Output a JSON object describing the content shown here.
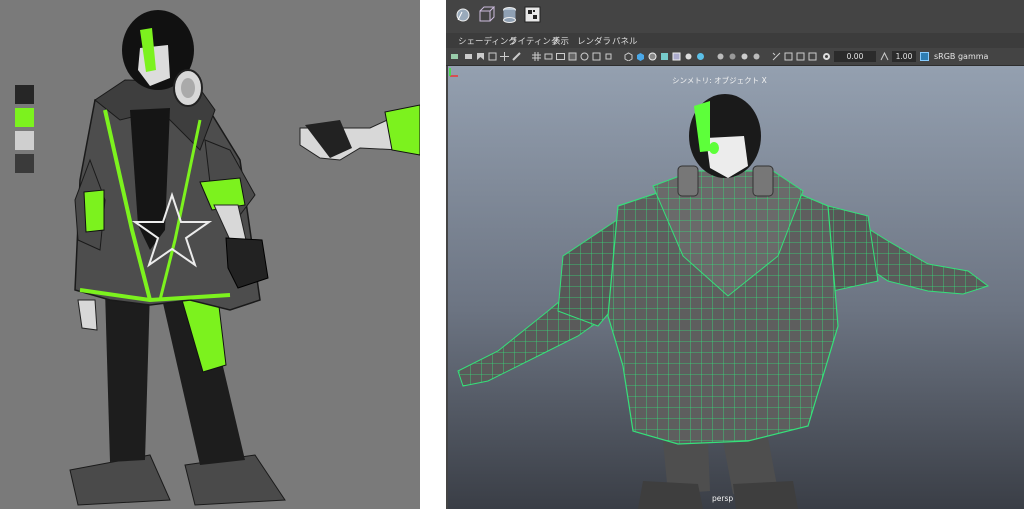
{
  "maya": {
    "menu": [
      "シェーディング",
      "ライティング",
      "表示",
      "レンダラ",
      "パネル"
    ],
    "toolbar": {
      "exposure_value": "0.00",
      "gamma_value": "1.00",
      "colorspace": "sRGB gamma"
    },
    "viewport": {
      "hud_title": "シンメトリ: オブジェクト X",
      "camera": "persp"
    }
  },
  "concept": {
    "swatches": [
      "#262626",
      "#7cf21e",
      "#cfcfcf",
      "#3a3a3a"
    ]
  },
  "colors": {
    "accent_green": "#7cf21e",
    "wire_green": "#35e07a",
    "concept_bg": "#7a7a7a"
  },
  "icons": {
    "shelf": [
      "sphere-lasso-icon",
      "wire-cube-icon",
      "cylinder-icon",
      "checker-icon"
    ]
  }
}
